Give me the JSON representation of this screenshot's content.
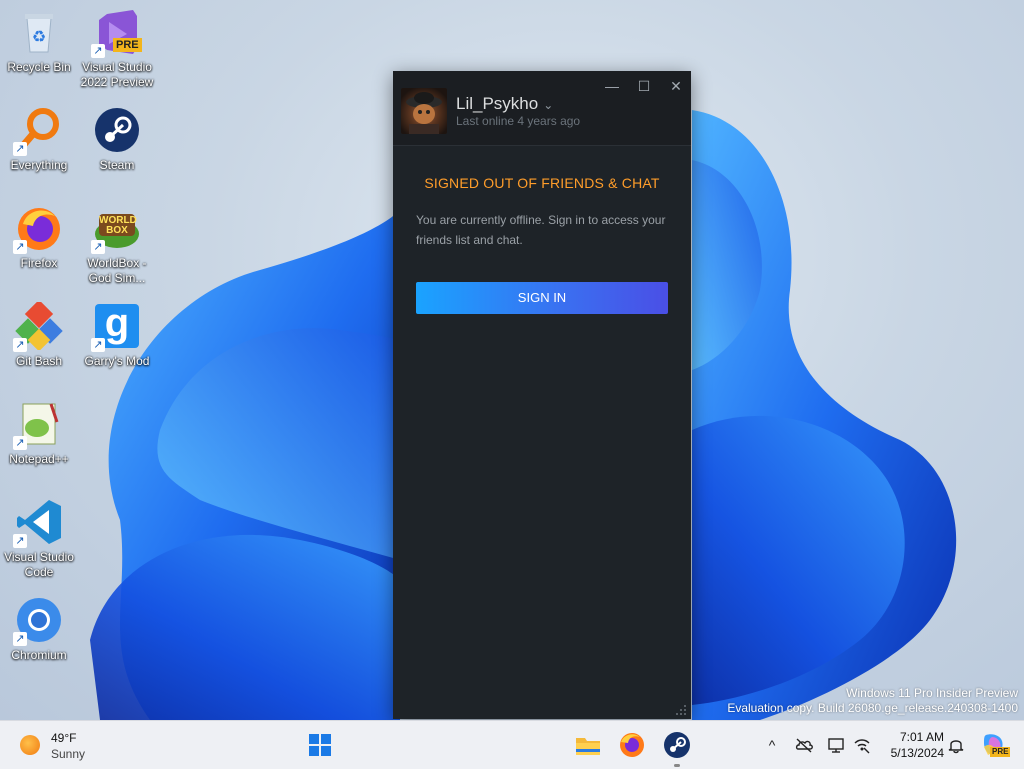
{
  "desktop": {
    "icons": [
      {
        "label": "Recycle Bin",
        "icon": "recycle-bin-icon"
      },
      {
        "label": "Visual Studio 2022 Preview",
        "icon": "visual-studio-icon",
        "badge": "PRE"
      },
      {
        "label": "Everything",
        "icon": "everything-search-icon"
      },
      {
        "label": "Steam",
        "icon": "steam-icon"
      },
      {
        "label": "Firefox",
        "icon": "firefox-icon"
      },
      {
        "label": "WorldBox - God Sim...",
        "icon": "worldbox-icon",
        "logo_text": "WORLD BOX"
      },
      {
        "label": "Git Bash",
        "icon": "git-bash-icon"
      },
      {
        "label": "Garry's Mod",
        "icon": "garrys-mod-icon",
        "logo_text": "g"
      },
      {
        "label": "Notepad++",
        "icon": "notepad-plus-plus-icon"
      },
      {
        "label": "Visual Studio Code",
        "icon": "vscode-icon"
      },
      {
        "label": "Chromium",
        "icon": "chromium-icon"
      }
    ]
  },
  "steam_window": {
    "username": "Lil_Psykho",
    "last_online": "Last online 4 years ago",
    "title": "SIGNED OUT OF FRIENDS & CHAT",
    "message": "You are currently offline. Sign in to access your friends list and chat.",
    "sign_in_label": "SIGN IN",
    "controls": {
      "minimize": "—",
      "maximize": "☐",
      "close": "✕"
    },
    "colors": {
      "background": "#1e2328",
      "title": "#ff9d2a",
      "button_from": "#1aa3ff",
      "button_to": "#4a4fe6"
    }
  },
  "watermark": {
    "line1": "Windows 11 Pro Insider Preview",
    "line2": "Evaluation copy. Build 26080.ge_release.240308-1400"
  },
  "taskbar": {
    "weather": {
      "temperature": "49°F",
      "condition": "Sunny"
    },
    "pinned": [
      "windows-start-icon",
      "file-explorer-icon",
      "firefox-icon",
      "steam-icon"
    ],
    "tray": [
      "chevron-up-icon",
      "onedrive-icon",
      "display-icon",
      "network-icon"
    ],
    "clock": {
      "time": "7:01 AM",
      "date": "5/13/2024"
    },
    "copilot_badge": "PRE"
  }
}
